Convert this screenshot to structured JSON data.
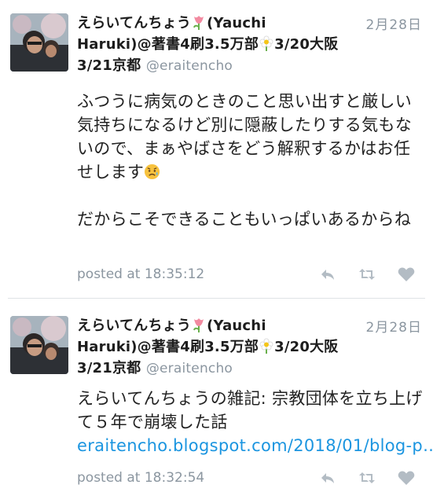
{
  "tweets": [
    {
      "name_part1": "えらいてんちょう",
      "name_part2": "(Yauchi Haruki)@著書4刷3.5万部",
      "name_part3": "3/20大阪3/21京都",
      "handle": "@eraitencho",
      "date": "2月28日",
      "body_lines": [
        "ふつうに病気のときのこと思い出すと厳しい気持ちになるけど別に隠蔽したりする気もないので、まぁやばさをどう解釈するかはお任せします"
      ],
      "body_second": "だからこそできることもいっぱいあるからね",
      "timestamp": "posted at 18:35:12"
    },
    {
      "name_part1": "えらいてんちょう",
      "name_part2": "(Yauchi Haruki)@著書4刷3.5万部",
      "name_part3": "3/20大阪3/21京都",
      "handle": "@eraitencho",
      "date": "2月28日",
      "body_text": "えらいてんちょうの雑記: 宗教団体を立ち上げて５年で崩壊した話",
      "link_text": "eraitencho.blogspot.com/2018/01/blog-p…",
      "timestamp": "posted at 18:32:54"
    }
  ],
  "icons": {
    "reply": "reply-icon",
    "retweet": "retweet-icon",
    "like": "heart-icon",
    "emoji": "sad-sweat-face-icon",
    "flower1": "tulip-icon",
    "flower2": "daisy-icon"
  },
  "colors": {
    "link": "#1b95e0",
    "meta": "#8b96a0",
    "divider": "#dfe3e6"
  }
}
